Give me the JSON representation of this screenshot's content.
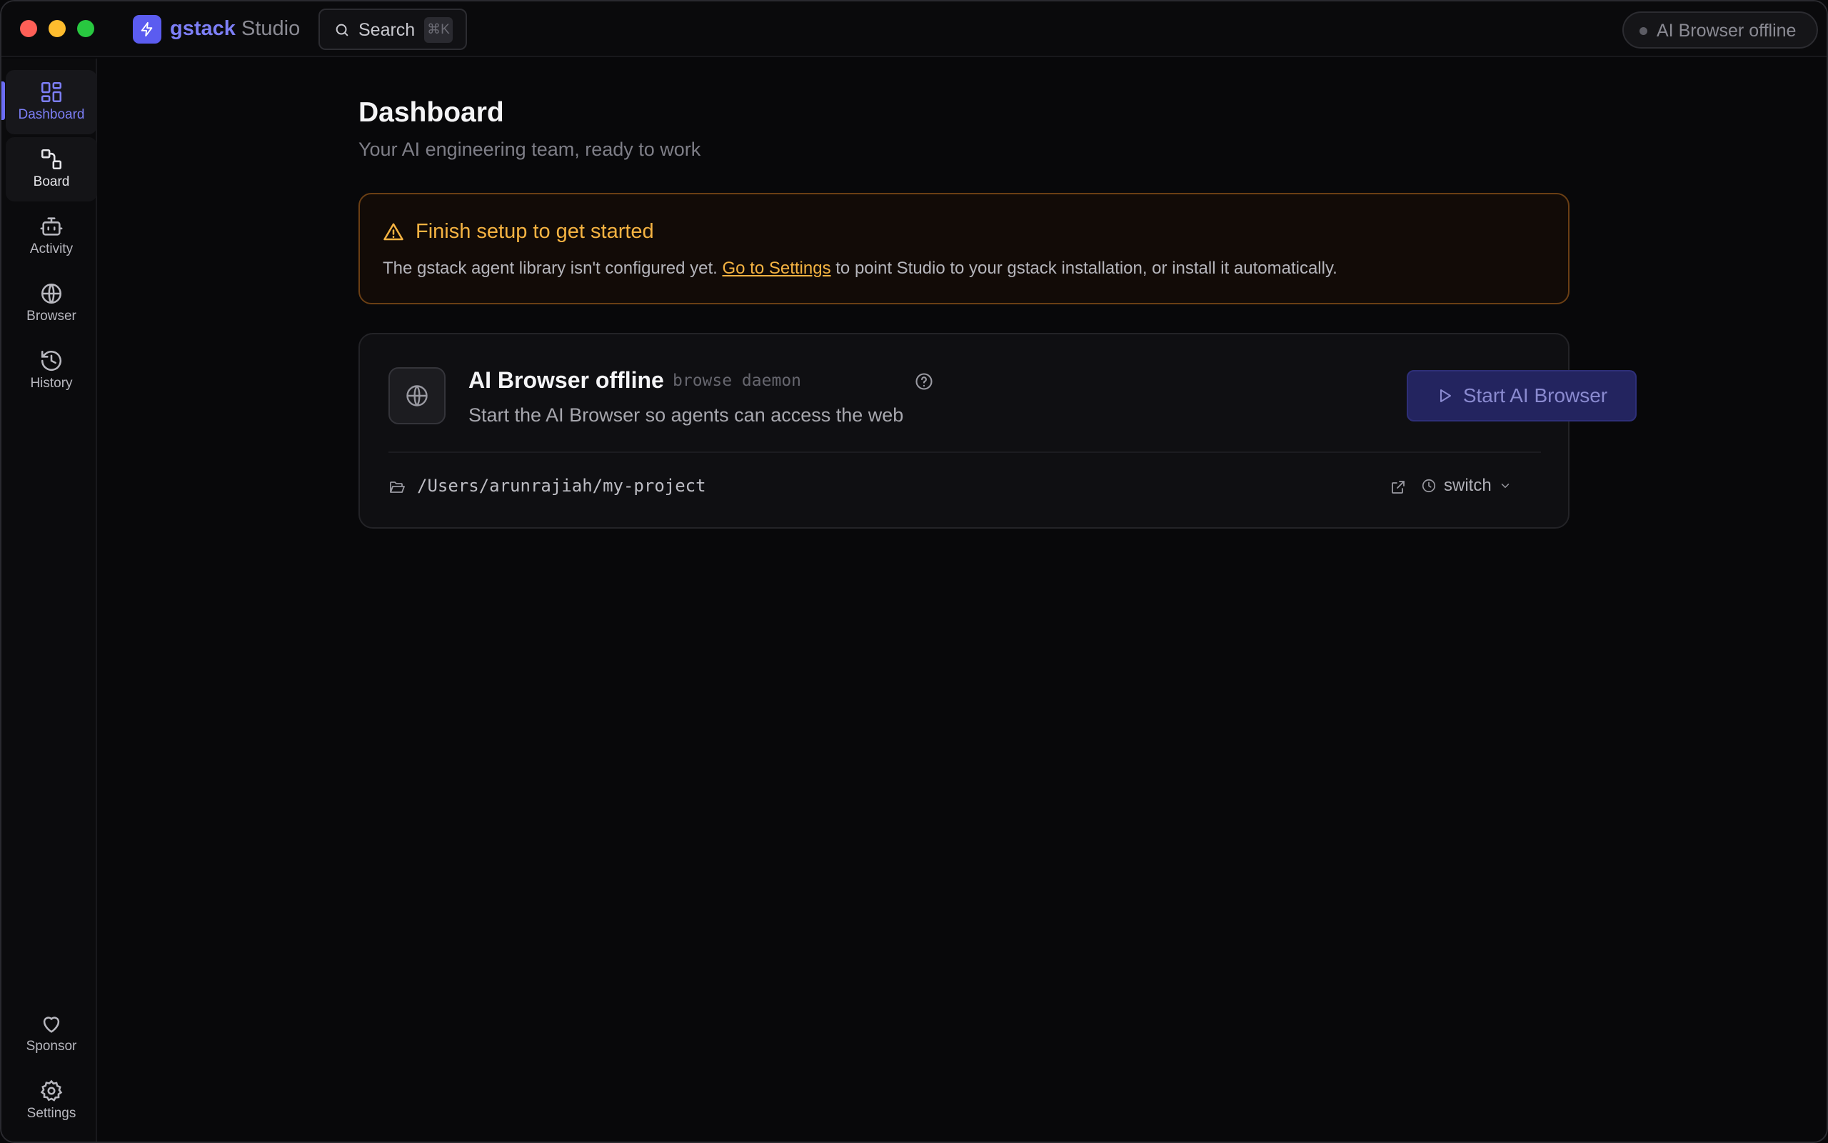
{
  "titlebar": {
    "brand_name": "gstack",
    "brand_sub": "Studio",
    "search_label": "Search",
    "search_shortcut": "⌘K",
    "status_text": "AI Browser offline"
  },
  "sidebar": {
    "items": [
      {
        "label": "Dashboard",
        "icon": "dashboard-icon"
      },
      {
        "label": "Board",
        "icon": "board-icon"
      },
      {
        "label": "Activity",
        "icon": "robot-icon"
      },
      {
        "label": "Browser",
        "icon": "globe-icon"
      },
      {
        "label": "History",
        "icon": "history-icon"
      }
    ],
    "bottom_items": [
      {
        "label": "Sponsor",
        "icon": "heart-icon"
      },
      {
        "label": "Settings",
        "icon": "gear-icon"
      }
    ]
  },
  "main": {
    "title": "Dashboard",
    "subtitle": "Your AI engineering team, ready to work",
    "setup_card": {
      "title": "Finish setup to get started",
      "body_before": "The gstack agent library isn't configured yet. ",
      "link_text": "Go to Settings",
      "body_after": " to point Studio to your gstack installation, or install it automatically."
    },
    "browser_card": {
      "title": "AI Browser offline",
      "tag": "browse daemon",
      "description": "Start the AI Browser so agents can access the web",
      "start_button": "Start AI Browser",
      "project_path": "/Users/arunrajiah/my-project",
      "switch_label": "switch"
    }
  },
  "colors": {
    "accent": "#6b6cf4",
    "warning": "#f5b342",
    "background": "#08080a"
  }
}
